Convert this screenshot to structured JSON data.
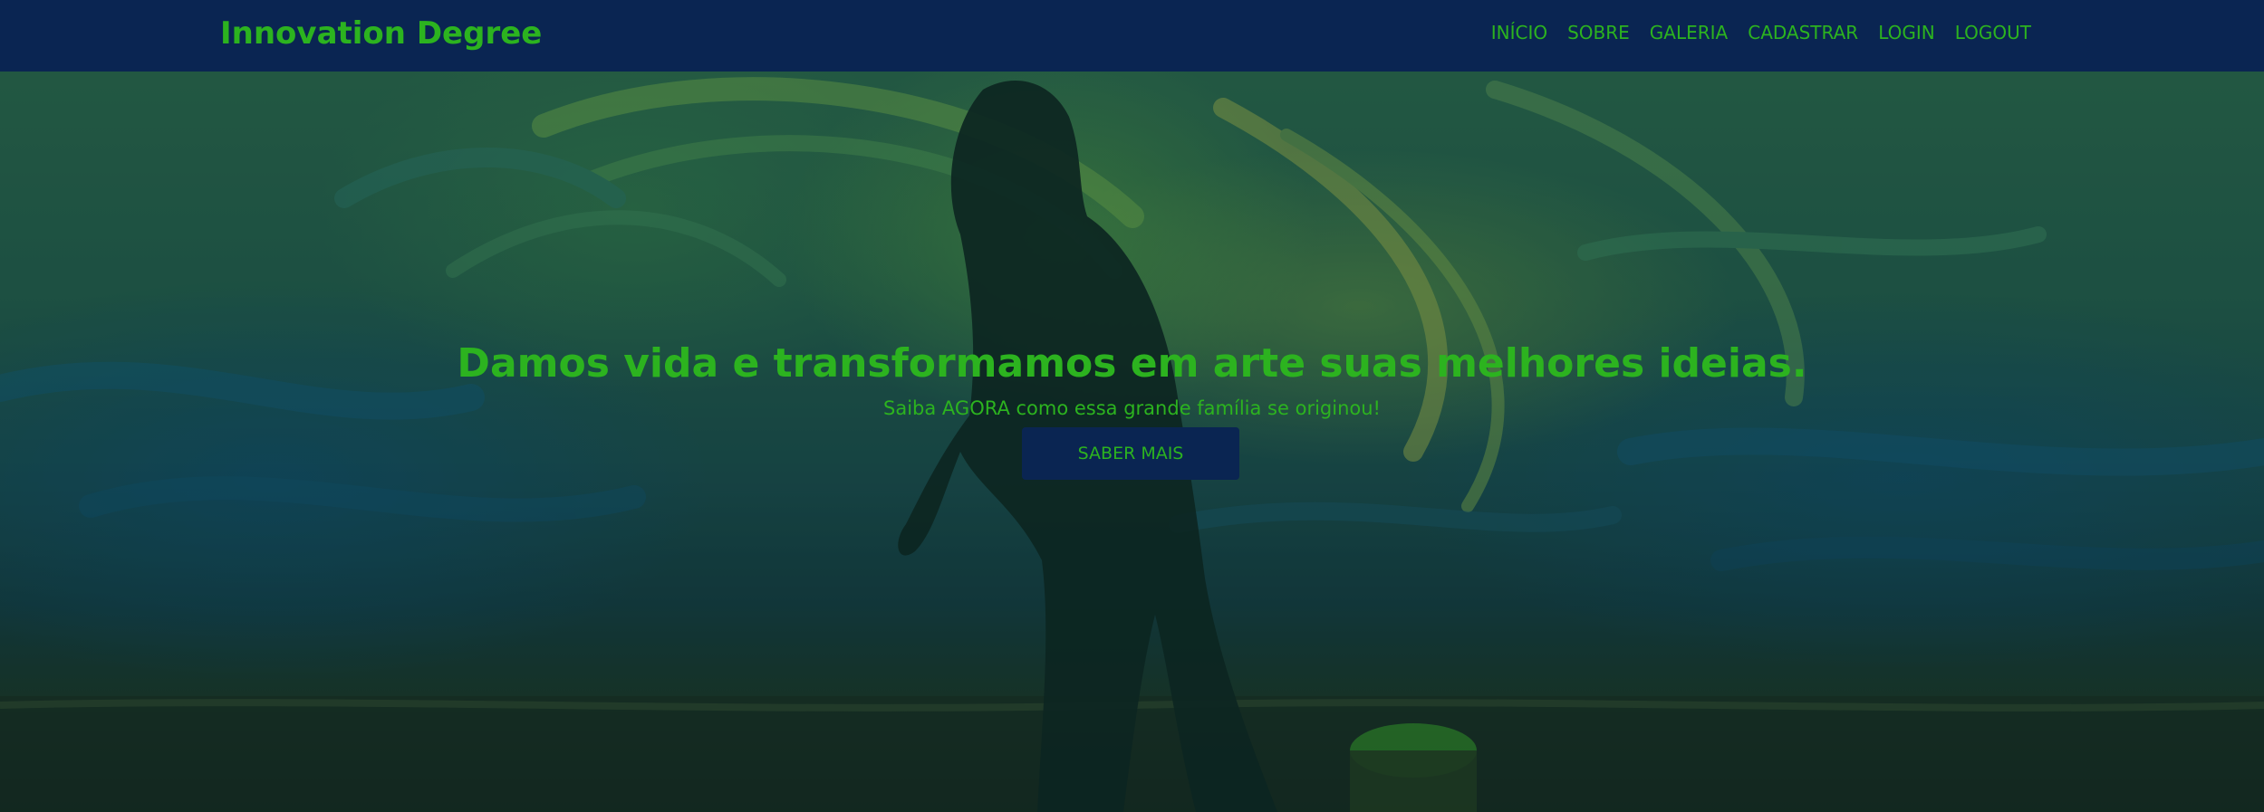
{
  "header": {
    "brand": "Innovation Degree",
    "nav": [
      {
        "label": "INÍCIO"
      },
      {
        "label": "SOBRE"
      },
      {
        "label": "GALERIA"
      },
      {
        "label": "CADASTRAR"
      },
      {
        "label": "LOGIN"
      },
      {
        "label": "LOGOUT"
      }
    ]
  },
  "hero": {
    "title": "Damos vida e transformamos em arte suas melhores ideias.",
    "subtitle": "Saiba AGORA como essa grande família se originou!",
    "button_label": "SABER MAIS"
  },
  "colors": {
    "navbar_bg": "#0a2552",
    "accent_green": "#2cb31f",
    "button_bg": "#0a2552"
  }
}
